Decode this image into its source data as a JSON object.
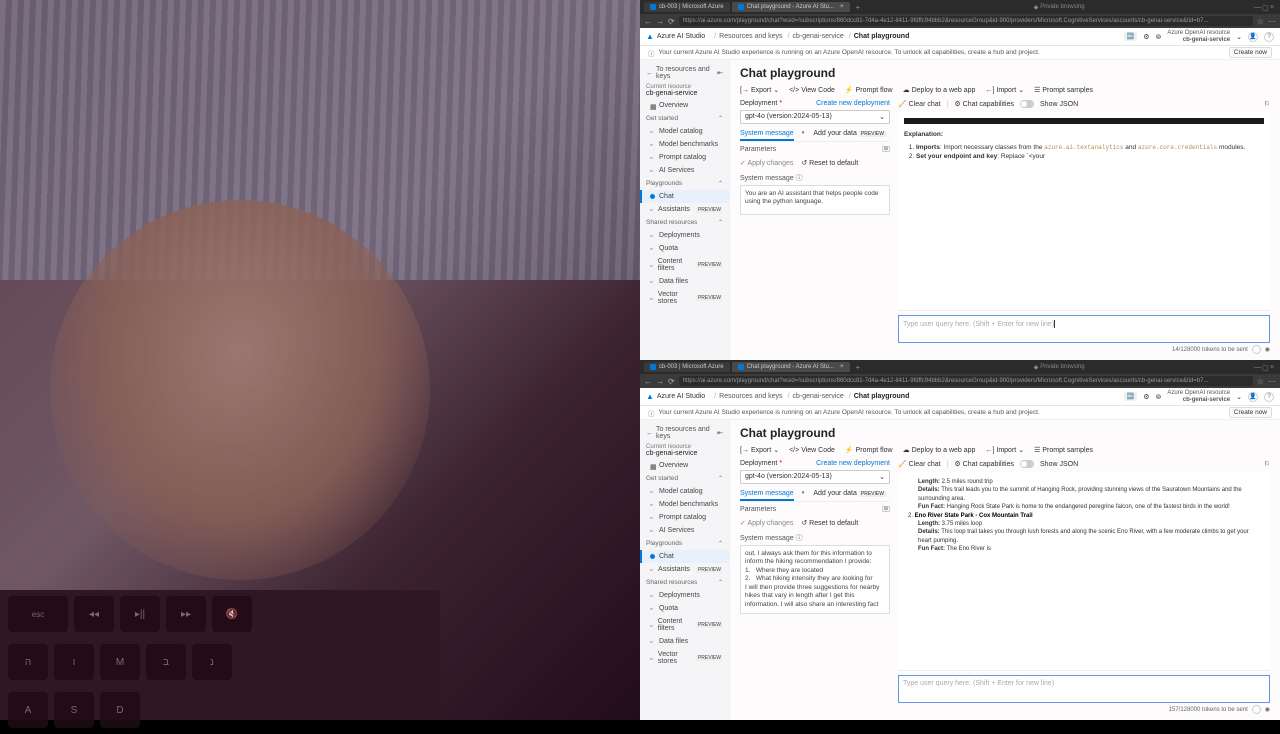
{
  "browser": {
    "tabs": [
      {
        "label": "cb-003 | Microsoft Azure"
      },
      {
        "label": "Chat playground - Azure AI Stu..."
      }
    ],
    "url": "https://ai.azure.com/playground/chat?wsid=/subscriptions/860dcc81-7d4a-4e12-8411-9fdffc94bbb2&resourceGroup&id-900/providers/Microsoft.CognitiveServices/accounts/cb-genai-service&tid=b7...",
    "private": "Private browsing"
  },
  "ribbon": {
    "studio": "Azure AI Studio",
    "crumbs": [
      "Resources and keys",
      "cb-genai-service",
      "Chat playground"
    ],
    "resource_label": "Azure OpenAI resource",
    "resource_name": "cb-genai-service"
  },
  "banner": {
    "text": "Your current Azure AI Studio experience is running on an Azure OpenAI resource. To unlock all capabilities, create a hub and project.",
    "create": "Create now"
  },
  "sidebar": {
    "back": "To resources and keys",
    "current_lbl": "Current resource",
    "current_name": "cb-genai-service",
    "overview": "Overview",
    "groups": {
      "get_started": "Get started",
      "playgrounds": "Playgrounds",
      "shared": "Shared resources"
    },
    "items": {
      "model_catalog": "Model catalog",
      "model_benchmarks": "Model benchmarks",
      "prompt_catalog": "Prompt catalog",
      "ai_services": "AI Services",
      "chat": "Chat",
      "assistants": "Assistants",
      "deployments": "Deployments",
      "quota": "Quota",
      "content_filters": "Content filters",
      "data_files": "Data files",
      "vector_stores": "Vector stores"
    },
    "preview": "PREVIEW"
  },
  "toolbar": {
    "export": "Export",
    "view_code": "View Code",
    "prompt_flow": "Prompt flow",
    "deploy": "Deploy to a web app",
    "import": "Import",
    "samples": "Prompt samples"
  },
  "page": {
    "title": "Chat playground",
    "deployment_label": "Deployment",
    "create_deployment": "Create new deployment",
    "deployment_value": "gpt-4o (version:2024-05-13)",
    "tabs": {
      "system": "System message",
      "add_data": "Add your data",
      "preview": "PREVIEW"
    },
    "parameters": "Parameters",
    "apply": "Apply changes",
    "reset": "Reset to default",
    "sysmsg_label": "System message"
  },
  "chat": {
    "clear": "Clear chat",
    "caps": "Chat capabilities",
    "show_json": "Show JSON",
    "placeholder": "Type user query here. (Shift + Enter for new line)",
    "send_suffix": "tokens to be sent"
  },
  "top": {
    "sysmsg": "You are an AI assistant that helps people code using the python language.",
    "tokens": "14/128000",
    "explanation_h": "Explanation:",
    "li1_a": "Imports",
    "li1_b": ": Import necessary classes from the ",
    "li1_c": "azure.ai.textanalytics",
    "li1_d": " and ",
    "li1_e": "azure.core.credentials",
    "li1_f": " modules.",
    "li2_a": "Set your endpoint and key",
    "li2_b": ": Replace `<your"
  },
  "bottom": {
    "tokens": "157/128000",
    "sysmsg": "out, I always ask them for this information to inform the hiking recommendation I provide:\n1.   Where they are located\n2.   What hiking intensity they are looking for\nI will then provide three suggestions for nearby hikes that vary in length after I get this information. I will also share an interesting fact",
    "out": {
      "length_lbl": "Length:",
      "length1": "2.5 miles round trip",
      "details_lbl": "Details:",
      "details1": "This trail leads you to the summit of Hanging Rock, providing stunning views of the Sauratown Mountains and the surrounding area.",
      "funfact_lbl": "Fun Fact:",
      "funfact1": "Hanging Rock State Park is home to the endangered peregrine falcon, one of the fastest birds in the world!",
      "item2": "Eno River State Park - Cox Mountain Trail",
      "length2": "3.75 miles loop",
      "details2": "This loop trail takes you through lush forests and along the scenic Eno River, with a few moderate climbs to get your heart pumping.",
      "funfact2": "The Eno River is"
    }
  },
  "kb": {
    "esc": "esc",
    "r1": [
      "◂◂",
      "▸||",
      "▸▸",
      "🔇"
    ],
    "r2": [
      "ה",
      "ו",
      "M",
      "ב",
      "נ"
    ],
    "r3": [
      "A",
      "S",
      "D"
    ]
  }
}
